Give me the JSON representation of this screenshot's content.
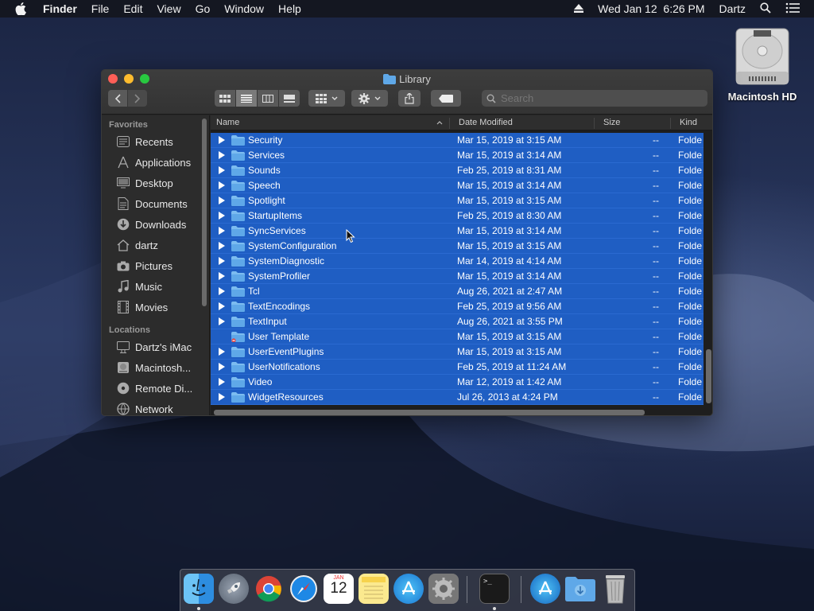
{
  "menubar": {
    "app": "Finder",
    "items": [
      "File",
      "Edit",
      "View",
      "Go",
      "Window",
      "Help"
    ],
    "clock": "Wed Jan 12  6:26 PM",
    "user": "Dartz"
  },
  "desktop": {
    "drive_label": "Macintosh HD"
  },
  "window": {
    "title": "Library",
    "search_placeholder": "Search"
  },
  "sidebar": {
    "favorites_heading": "Favorites",
    "favorites": [
      {
        "label": "Recents",
        "icon": "clock-icon"
      },
      {
        "label": "Applications",
        "icon": "applications-icon"
      },
      {
        "label": "Desktop",
        "icon": "desktop-icon"
      },
      {
        "label": "Documents",
        "icon": "document-icon"
      },
      {
        "label": "Downloads",
        "icon": "download-icon"
      },
      {
        "label": "dartz",
        "icon": "home-icon"
      },
      {
        "label": "Pictures",
        "icon": "camera-icon"
      },
      {
        "label": "Music",
        "icon": "music-icon"
      },
      {
        "label": "Movies",
        "icon": "film-icon"
      }
    ],
    "locations_heading": "Locations",
    "locations": [
      {
        "label": "Dartz's iMac",
        "icon": "imac-icon"
      },
      {
        "label": "Macintosh...",
        "icon": "disk-icon"
      },
      {
        "label": "Remote Di...",
        "icon": "optical-disc-icon"
      },
      {
        "label": "Network",
        "icon": "network-icon"
      }
    ]
  },
  "columns": {
    "name": "Name",
    "date": "Date Modified",
    "size": "Size",
    "kind": "Kind"
  },
  "rows": [
    {
      "name": "Security",
      "date": "Mar 15, 2019 at 3:15 AM",
      "size": "--",
      "kind": "Folder",
      "expandable": true
    },
    {
      "name": "Services",
      "date": "Mar 15, 2019 at 3:14 AM",
      "size": "--",
      "kind": "Folder",
      "expandable": true
    },
    {
      "name": "Sounds",
      "date": "Feb 25, 2019 at 8:31 AM",
      "size": "--",
      "kind": "Folder",
      "expandable": true
    },
    {
      "name": "Speech",
      "date": "Mar 15, 2019 at 3:14 AM",
      "size": "--",
      "kind": "Folder",
      "expandable": true
    },
    {
      "name": "Spotlight",
      "date": "Mar 15, 2019 at 3:15 AM",
      "size": "--",
      "kind": "Folder",
      "expandable": true
    },
    {
      "name": "StartupItems",
      "date": "Feb 25, 2019 at 8:30 AM",
      "size": "--",
      "kind": "Folder",
      "expandable": true
    },
    {
      "name": "SyncServices",
      "date": "Mar 15, 2019 at 3:14 AM",
      "size": "--",
      "kind": "Folder",
      "expandable": true
    },
    {
      "name": "SystemConfiguration",
      "date": "Mar 15, 2019 at 3:15 AM",
      "size": "--",
      "kind": "Folder",
      "expandable": true
    },
    {
      "name": "SystemDiagnostic",
      "date": "Mar 14, 2019 at 4:14 AM",
      "size": "--",
      "kind": "Folder",
      "expandable": true
    },
    {
      "name": "SystemProfiler",
      "date": "Mar 15, 2019 at 3:14 AM",
      "size": "--",
      "kind": "Folder",
      "expandable": true
    },
    {
      "name": "Tcl",
      "date": "Aug 26, 2021 at 2:47 AM",
      "size": "--",
      "kind": "Folder",
      "expandable": true
    },
    {
      "name": "TextEncodings",
      "date": "Feb 25, 2019 at 9:56 AM",
      "size": "--",
      "kind": "Folder",
      "expandable": true
    },
    {
      "name": "TextInput",
      "date": "Aug 26, 2021 at 3:55 PM",
      "size": "--",
      "kind": "Folder",
      "expandable": true
    },
    {
      "name": "User Template",
      "date": "Mar 15, 2019 at 3:15 AM",
      "size": "--",
      "kind": "Folder",
      "expandable": false
    },
    {
      "name": "UserEventPlugins",
      "date": "Mar 15, 2019 at 3:15 AM",
      "size": "--",
      "kind": "Folder",
      "expandable": true
    },
    {
      "name": "UserNotifications",
      "date": "Feb 25, 2019 at 11:24 AM",
      "size": "--",
      "kind": "Folder",
      "expandable": true
    },
    {
      "name": "Video",
      "date": "Mar 12, 2019 at 1:42 AM",
      "size": "--",
      "kind": "Folder",
      "expandable": true
    },
    {
      "name": "WidgetResources",
      "date": "Jul 26, 2013 at 4:24 PM",
      "size": "--",
      "kind": "Folder",
      "expandable": true
    }
  ],
  "dock": {
    "calendar_month": "JAN",
    "calendar_day": "12",
    "apps": [
      "Finder",
      "Launchpad",
      "Chrome",
      "Safari",
      "Calendar",
      "Notes",
      "App Store",
      "System Preferences",
      "Terminal",
      "Applications",
      "Downloads",
      "Trash"
    ]
  },
  "colors": {
    "selection": "#1f5ec3",
    "folder": "#5fa8e8",
    "window_bg": "#262626"
  }
}
